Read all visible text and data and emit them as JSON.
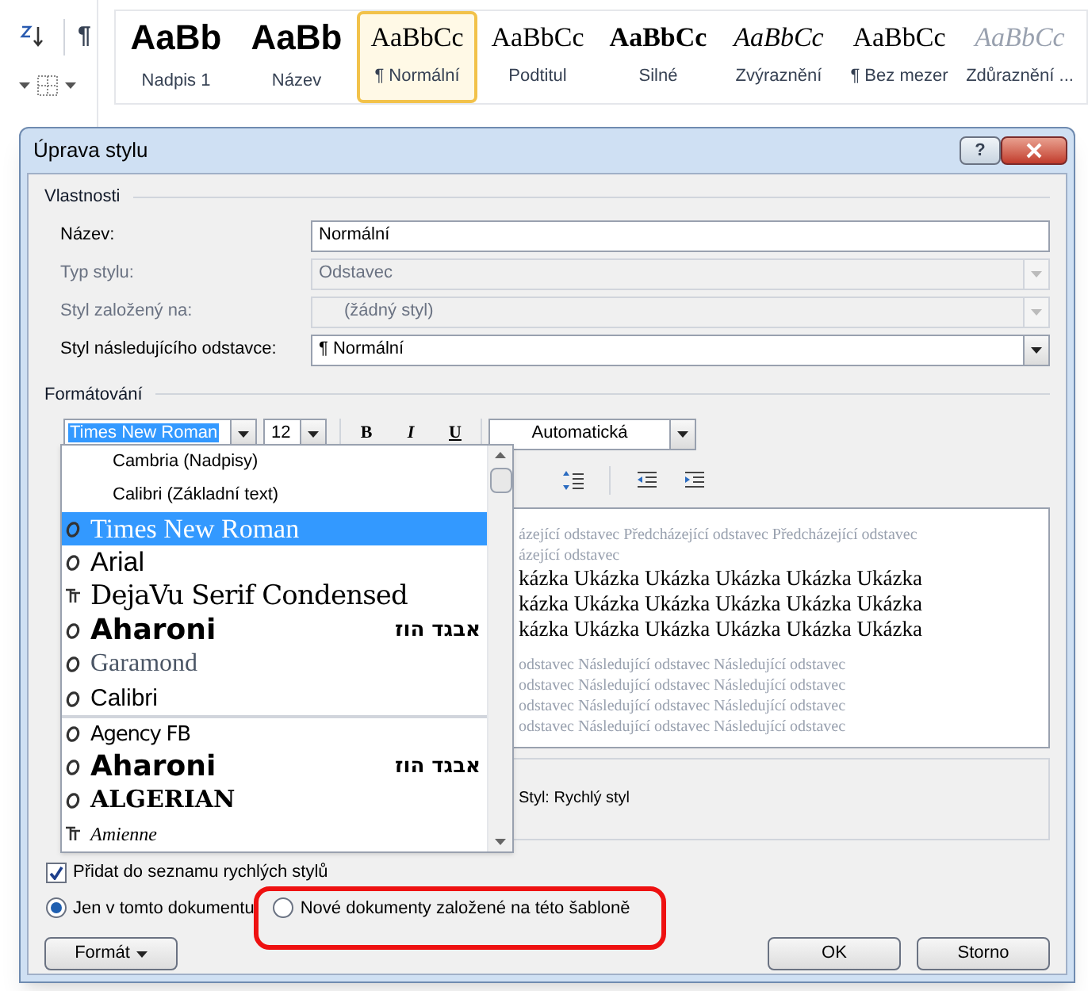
{
  "ribbon": {
    "pilcrow": "¶",
    "gallery": [
      {
        "preview": "AaBb",
        "label": "Nadpis 1",
        "selected": false
      },
      {
        "preview": "AaBb",
        "label": "Název",
        "selected": false
      },
      {
        "preview": "AaBbCc",
        "label": "¶ Normální",
        "selected": true
      },
      {
        "preview": "AaBbCc",
        "label": "Podtitul",
        "selected": false
      },
      {
        "preview": "AaBbCc",
        "label": "Silné",
        "selected": false
      },
      {
        "preview": "AaBbCc",
        "label": "Zvýraznění",
        "selected": false
      },
      {
        "preview": "AaBbCc",
        "label": "¶ Bez mezer",
        "selected": false
      },
      {
        "preview": "AaBbCc",
        "label": "Zdůraznění ...",
        "selected": false
      }
    ]
  },
  "dialog": {
    "title": "Úprava stylu",
    "help": "?",
    "properties": {
      "heading": "Vlastnosti",
      "rows": [
        {
          "label": "Název:",
          "value": "Normální",
          "disabled": false,
          "kind": "text"
        },
        {
          "label": "Typ stylu:",
          "value": "Odstavec",
          "disabled": true,
          "kind": "combo"
        },
        {
          "label": "Styl založený na:",
          "value": "(žádný styl)",
          "disabled": true,
          "kind": "combo"
        },
        {
          "label": "Styl následujícího odstavce:",
          "value": "¶ Normální",
          "disabled": false,
          "kind": "combo"
        }
      ]
    },
    "formatting": {
      "heading": "Formátování",
      "font": "Times New Roman",
      "size": "12",
      "bold": "B",
      "italic": "I",
      "underline": "U",
      "font_color": "Automatická",
      "font_list": [
        {
          "name": "Cambria (Nadpisy)",
          "kind": "theme",
          "selected": false
        },
        {
          "name": "Calibri (Základní text)",
          "kind": "theme",
          "selected": false
        },
        {
          "name": "Times New Roman",
          "kind": "opentype",
          "selected": true
        },
        {
          "name": "Arial",
          "kind": "opentype",
          "selected": false
        },
        {
          "name": "DejaVu Serif Condensed",
          "kind": "truetype",
          "selected": false
        },
        {
          "name": "Aharoni",
          "kind": "opentype",
          "sample": "אבגד הוז",
          "selected": false
        },
        {
          "name": "Garamond",
          "kind": "opentype",
          "selected": false
        },
        {
          "name": "Calibri",
          "kind": "opentype",
          "selected": false
        },
        {
          "name": "Agency FB",
          "kind": "opentype",
          "selected": false
        },
        {
          "name": "Aharoni",
          "kind": "opentype",
          "sample": "אבגד הוז",
          "selected": false
        },
        {
          "name": "ALGERIAN",
          "kind": "opentype",
          "selected": false
        },
        {
          "name": "Amienne",
          "kind": "truetype",
          "selected": false
        }
      ],
      "preview": {
        "previous": [
          "ázející odstavec Předcházející odstavec Předcházející odstavec",
          "ázející odstavec"
        ],
        "sample": [
          "kázka Ukázka Ukázka Ukázka Ukázka Ukázka",
          "kázka Ukázka Ukázka Ukázka Ukázka Ukázka",
          "kázka Ukázka Ukázka Ukázka Ukázka Ukázka"
        ],
        "following": [
          "odstavec Následující odstavec Následující odstavec",
          "odstavec Následující odstavec Následující odstavec",
          "odstavec Následující odstavec Následující odstavec",
          "odstavec Následující odstavec Následující odstavec"
        ]
      },
      "description": "Styl: Rychlý styl"
    },
    "add_to_quick": {
      "label": "Přidat do seznamu rychlých stylů",
      "checked": true
    },
    "scope": [
      {
        "label": "Jen v tomto dokumentu",
        "selected": true
      },
      {
        "label": "Nové dokumenty založené na této šabloně",
        "selected": false
      }
    ],
    "buttons": {
      "format": "Formát",
      "ok": "OK",
      "cancel": "Storno"
    }
  }
}
